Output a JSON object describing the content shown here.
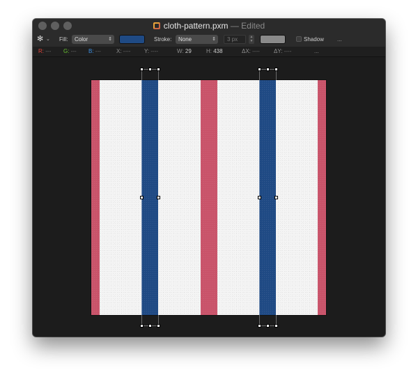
{
  "window": {
    "title": "cloth-pattern.pxm",
    "edited_label": "— Edited",
    "doc_icon": "pixelmator-doc-icon"
  },
  "toolbar": {
    "gear_icon": "gear-icon",
    "gear_caret": "⌄",
    "fill_label": "Fill:",
    "fill_type": "Color",
    "fill_color": "#1f4a84",
    "stroke_label": "Stroke:",
    "stroke_type": "None",
    "stroke_width": "3 px",
    "stroke_color": "#8a8a8a",
    "shadow_label": "Shadow",
    "more_label": "..."
  },
  "info": {
    "r_label": "R:",
    "r_value": "---",
    "g_label": "G:",
    "g_value": "---",
    "b_label": "B:",
    "b_value": "---",
    "x_label": "X:",
    "x_value": "----",
    "y_label": "Y:",
    "y_value": "----",
    "w_label": "W:",
    "w_value": "29",
    "h_label": "H:",
    "h_value": "438",
    "dx_label": "ΔX:",
    "dx_value": "----",
    "dy_label": "ΔY:",
    "dy_value": "----",
    "more_label": "..."
  },
  "canvas": {
    "background": "#f4f4f4",
    "stripe_red": "#c9536a",
    "stripe_blue": "#1f4a84"
  }
}
